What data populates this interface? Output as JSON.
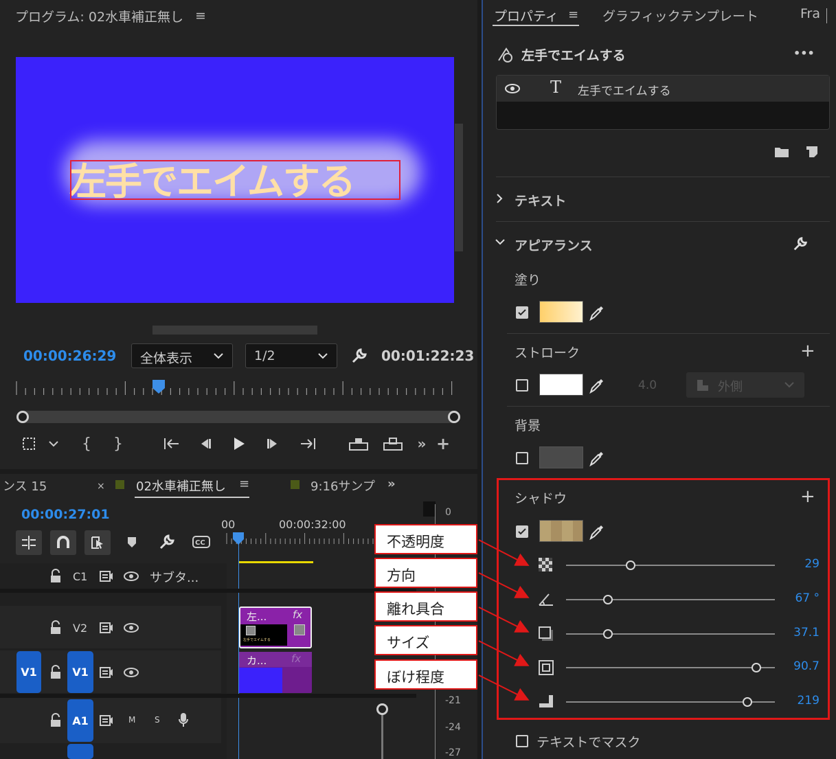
{
  "program": {
    "title": "プログラム: 02水車補正無し",
    "menu_icon": "hamburger-icon",
    "title_text": "左手でエイムする",
    "timecode": "00:00:26:29",
    "zoom": "全体表示",
    "resolution": "1/2",
    "duration": "00:01:22:23",
    "playhead_fraction": 0.325
  },
  "timeline": {
    "tabs": [
      "ンス 15",
      "02水車補正無し",
      "9:16サンプ"
    ],
    "close": "×",
    "menu": "≡",
    "more": "»",
    "timecode": "00:00:27:01",
    "ruler": [
      "00",
      "00:00:32:00"
    ],
    "tracks": {
      "c1": {
        "label": "C1",
        "name": "サブタ..."
      },
      "v2": {
        "label": "V2"
      },
      "v1": {
        "label": "V1",
        "src": "V1"
      },
      "a1": {
        "label": "A1",
        "m": "M",
        "s": "S"
      }
    },
    "clips": {
      "v2": {
        "label": "左...",
        "fx": "fx",
        "thumb": "左手でエイムする"
      },
      "v1": {
        "label": "カ...",
        "fx": "fx"
      }
    },
    "meter": [
      "0",
      "-21",
      "-24",
      "-27"
    ]
  },
  "properties": {
    "tabs": [
      "プロパティ",
      "グラフィックテンプレート",
      "Fra"
    ],
    "layer_title": "左手でエイムする",
    "more": "•••",
    "layer_item": "左手でエイムする",
    "sections": {
      "text": "テキスト",
      "appearance": "アピアランス"
    },
    "fill": {
      "label": "塗り",
      "checked": true,
      "color": "#ffd98a"
    },
    "stroke": {
      "label": "ストローク",
      "checked": false,
      "color": "#ffffff",
      "width": "4.0",
      "position": "外側"
    },
    "background": {
      "label": "背景",
      "checked": false
    },
    "shadow": {
      "label": "シャドウ",
      "checked": true,
      "color": "#b8a272",
      "rows": [
        {
          "icon": "opacity-icon",
          "value": "29",
          "fraction": 0.31
        },
        {
          "icon": "angle-icon",
          "value": "67 °",
          "fraction": 0.2
        },
        {
          "icon": "distance-icon",
          "value": "37.1",
          "fraction": 0.2
        },
        {
          "icon": "size-icon",
          "value": "90.7",
          "fraction": 0.91
        },
        {
          "icon": "blur-icon",
          "value": "219",
          "fraction": 0.87
        }
      ]
    },
    "mask": "テキストでマスク",
    "plus": "+"
  },
  "callouts": [
    "不透明度",
    "方向",
    "離れ具合",
    "サイズ",
    "ぼけ程度"
  ]
}
